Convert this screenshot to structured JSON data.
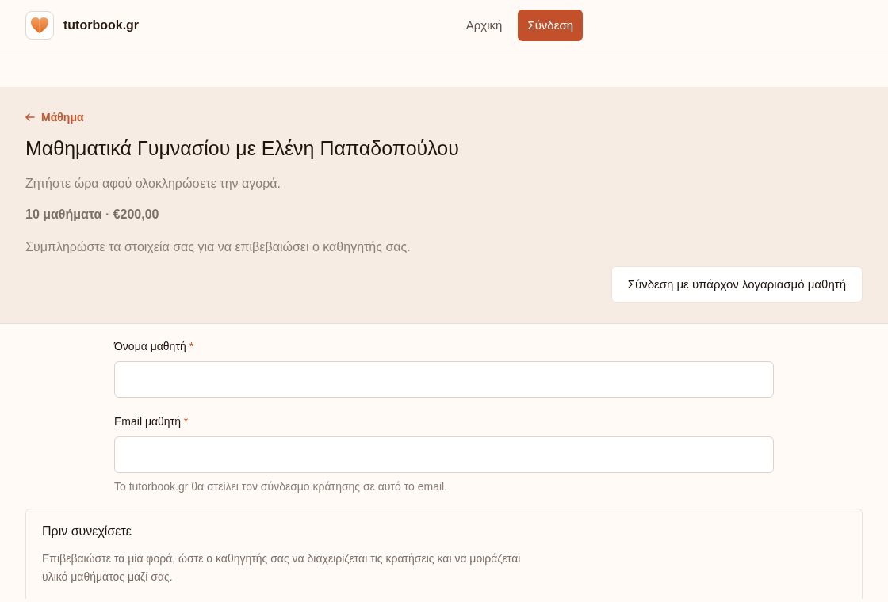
{
  "navbar": {
    "brand": "tutorbook.gr",
    "links": [
      {
        "label": "Αρχική",
        "kind": "link"
      },
      {
        "label": "Σύνδεση",
        "kind": "button"
      }
    ]
  },
  "header": {
    "back_link": "Μάθημα",
    "title": "Μαθηματικά Γυμνασίου με Ελένη Παπαδοπούλου",
    "note": "Ζητήστε ώρα αφού ολοκληρώσετε την αγορά.",
    "summary": "10 μαθήματα · €200,00",
    "instruction": "Συμπληρώστε τα στοιχεία σας για να επιβεβαιώσει ο καθηγητής σας.",
    "login_button": "Σύνδεση με υπάρχον λογαριασμό μαθητή"
  },
  "form": {
    "fields": [
      {
        "label": "Όνομα μαθητή",
        "required_mark": "*"
      },
      {
        "label": "Email μαθητή",
        "required_mark": "*",
        "help": "Το tutorbook.gr θα στείλει τον σύνδεσμο κράτησης σε αυτό το email."
      }
    ]
  },
  "notice": {
    "title": "Πριν συνεχίσετε",
    "text": "Επιβεβαιώστε τα μία φορά, ώστε ο καθηγητής σας να διαχειρίζεται τις κρατήσεις και να μοιράζεται υλικό μαθήματος μαζί σας."
  }
}
